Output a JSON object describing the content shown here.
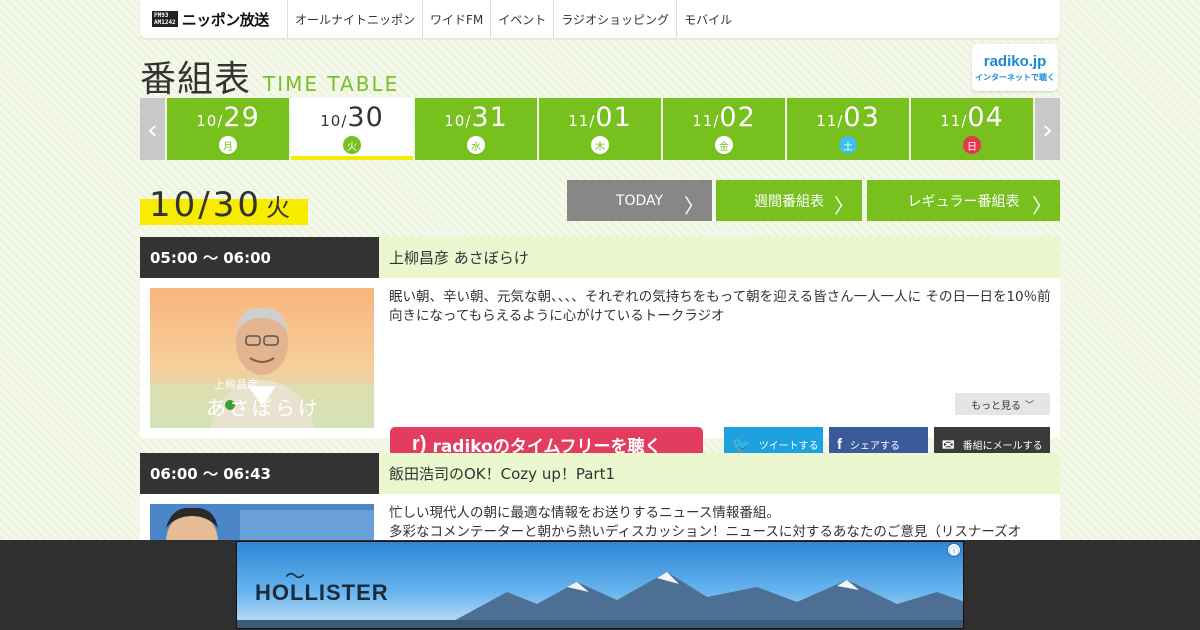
{
  "site": {
    "logo_badge_top": "FM93",
    "logo_badge_bottom": "AM1242",
    "logo_name": "ニッポン放送"
  },
  "nav": [
    "オールナイトニッポン",
    "ワイドFM",
    "イベント",
    "ラジオショッピング",
    "モバイル"
  ],
  "header": {
    "title_ja": "番組表",
    "title_en": "TIME TABLE",
    "radiko_logo": "radiko.jp",
    "radiko_sub": "インターネットで聴く"
  },
  "dates": [
    {
      "month": "10/",
      "day": "29",
      "weekday": "月",
      "type": "weekday"
    },
    {
      "month": "10/",
      "day": "30",
      "weekday": "火",
      "type": "weekday",
      "active": true
    },
    {
      "month": "10/",
      "day": "31",
      "weekday": "水",
      "type": "weekday"
    },
    {
      "month": "11/",
      "day": "01",
      "weekday": "木",
      "type": "weekday"
    },
    {
      "month": "11/",
      "day": "02",
      "weekday": "金",
      "type": "weekday"
    },
    {
      "month": "11/",
      "day": "03",
      "weekday": "土",
      "type": "sat"
    },
    {
      "month": "11/",
      "day": "04",
      "weekday": "日",
      "type": "sun"
    }
  ],
  "selected": {
    "date": "10/30",
    "weekday": "火"
  },
  "buttons": {
    "today": "TODAY",
    "weekly": "週間番組表",
    "regular": "レギュラー番組表"
  },
  "programs": [
    {
      "time": "05:00 ～ 06:00",
      "title": "上柳昌彦 あさぼらけ",
      "description": "眠い朝、辛い朝、元気な朝、、、、それぞれの気持ちをもって朝を迎える皆さん一人一人に その日一日を10％前向きになってもらえるように心がけているトークラジオ",
      "thumb_caption_small": "上柳昌彦",
      "thumb_caption": "あさぼらけ",
      "more": "もっと見る",
      "radiko": "radikoのタイムフリーを聴く",
      "tweet": "ツイートする",
      "share": "シェアする",
      "mail": "番組にメールする"
    },
    {
      "time": "06:00 ～ 06:43",
      "title": "飯田浩司のOK！Cozy up！Part1",
      "description_line1": "忙しい現代人の朝に最適な情報をお送りするニュース情報番組。",
      "description_line2": "多彩なコメンテーターと朝から熱いディスカッション！ニュースに対するあなたのご意見（リスナーズオ"
    }
  ],
  "ad": {
    "brand": "HOLLISTER",
    "info": "ⓘ"
  },
  "colors": {
    "green": "#78c01e",
    "yellow": "#f7ec00",
    "pink": "#e23c5f",
    "twitter": "#1ea1df",
    "facebook": "#3b5a9a"
  }
}
